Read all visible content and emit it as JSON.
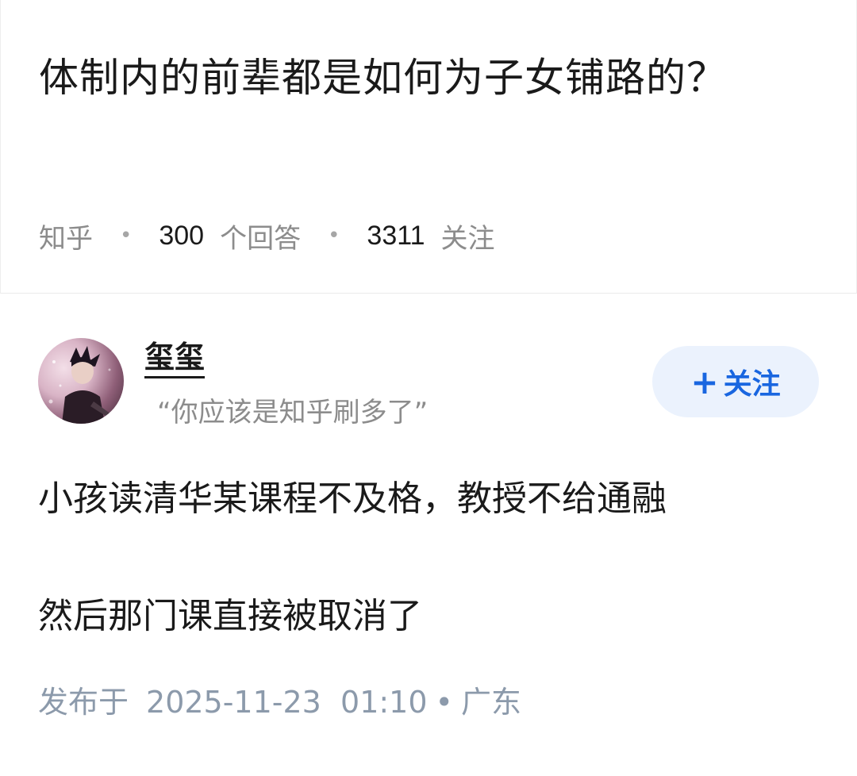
{
  "question": {
    "title": "体制内的前辈都是如何为子女铺路的？",
    "source": "知乎",
    "answer_count": "300",
    "answer_count_label": "个回答",
    "follower_count": "3311",
    "follower_label": "关注"
  },
  "answer": {
    "author_name": "玺玺",
    "author_bio": "“你应该是知乎刷多了”",
    "follow_button_label": "关注",
    "content_lines": [
      "小孩读清华某课程不及格，教授不给通融",
      "然后那门课直接被取消了"
    ],
    "published_label": "发布于",
    "published_time": "2025-11-23  01:10",
    "location": "广东"
  },
  "colors": {
    "accent": "#1966e0",
    "follow_bg": "#ebf2fd",
    "meta_gray": "#8c8c8c"
  }
}
